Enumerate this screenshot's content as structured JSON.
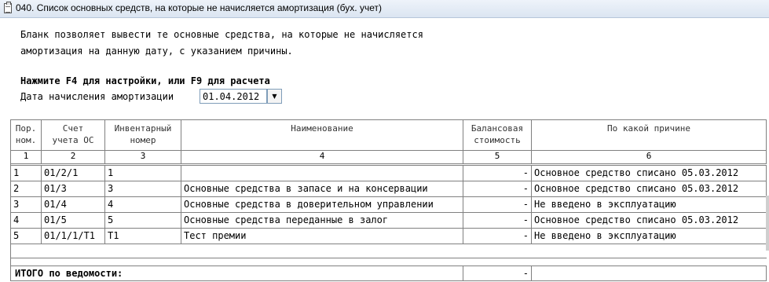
{
  "window": {
    "title": "040. Список основных средств, на которые не начисляется амортизация (бух. учет)"
  },
  "intro": {
    "line1": "Бланк позволяет вывести те основные средства, на которые не начисляется",
    "line2": "амортизация на данную дату, с указанием причины.",
    "hint": "Нажмите F4 для настройки, или F9 для расчета"
  },
  "date_field": {
    "label": "Дата начисления амортизации",
    "value": "01.04.2012"
  },
  "table": {
    "headers": [
      {
        "l1": "Пор.",
        "l2": "ном."
      },
      {
        "l1": "Счет",
        "l2": "учета ОС"
      },
      {
        "l1": "Инвентарный",
        "l2": "номер"
      },
      {
        "l1": "Наименование",
        "l2": ""
      },
      {
        "l1": "Балансовая",
        "l2": "стоимость"
      },
      {
        "l1": "По какой причине",
        "l2": ""
      }
    ],
    "col_numbers": [
      "1",
      "2",
      "3",
      "4",
      "5",
      "6"
    ],
    "rows": [
      {
        "n": "1",
        "acc": "01/2/1",
        "inv": "1",
        "name": "",
        "cost": "-",
        "reason": "Основное средство списано 05.03.2012"
      },
      {
        "n": "2",
        "acc": "01/3",
        "inv": "3",
        "name": "Основные средства в запасе и на консервации",
        "cost": "-",
        "reason": "Основное средство списано 05.03.2012"
      },
      {
        "n": "3",
        "acc": "01/4",
        "inv": "4",
        "name": "Основные средства в доверительном управлении",
        "cost": "-",
        "reason": "Не введено в эксплуатацию"
      },
      {
        "n": "4",
        "acc": "01/5",
        "inv": "5",
        "name": "Основные средства переданные в залог",
        "cost": "-",
        "reason": "Основное средство списано 05.03.2012"
      },
      {
        "n": "5",
        "acc": "01/1/1/T1",
        "inv": "T1",
        "name": "Тест премии",
        "cost": "-",
        "reason": "Не введено в эксплуатацию"
      }
    ],
    "total": {
      "label": "ИТОГО по ведомости:",
      "cost": "-"
    }
  }
}
